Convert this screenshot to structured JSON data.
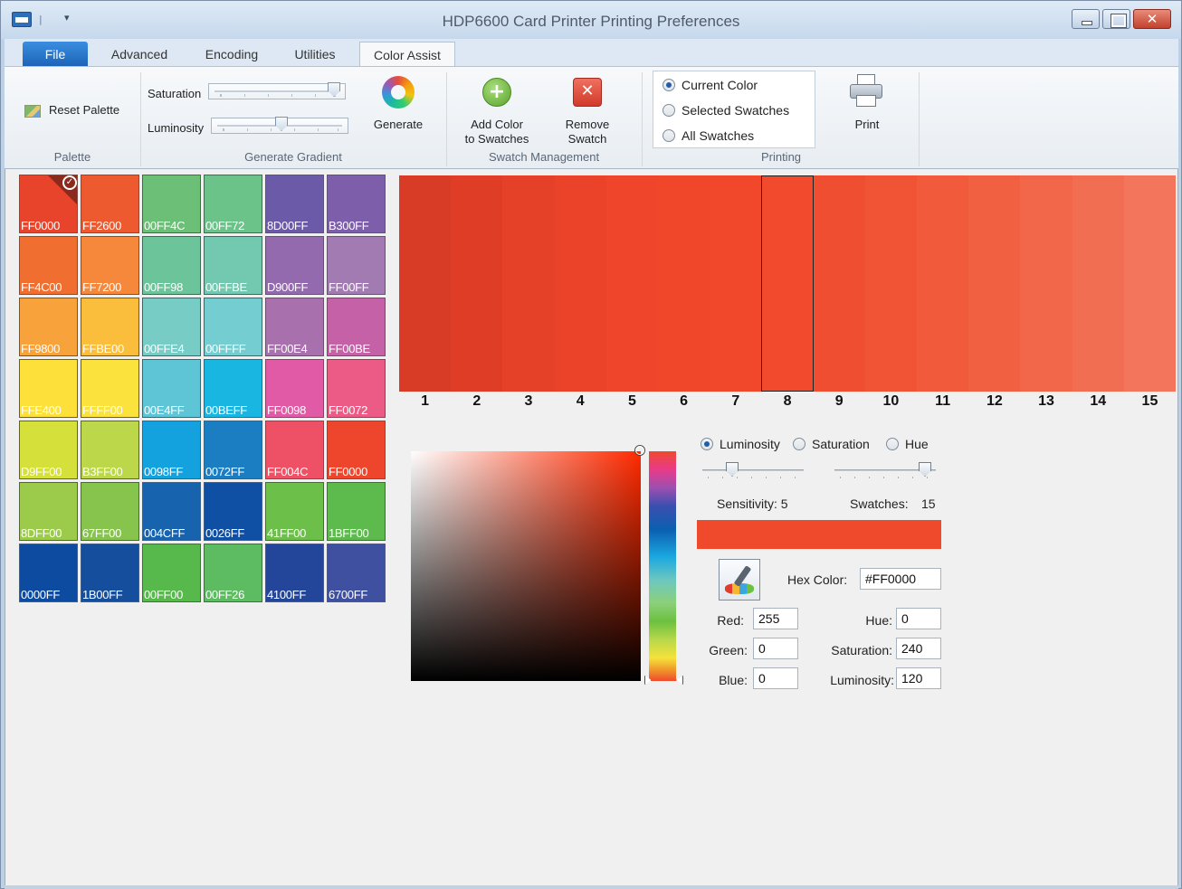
{
  "window": {
    "title": "HDP6600 Card Printer Printing Preferences"
  },
  "tabs": [
    {
      "label": "File"
    },
    {
      "label": "Advanced"
    },
    {
      "label": "Encoding"
    },
    {
      "label": "Utilities"
    },
    {
      "label": "Color Assist"
    }
  ],
  "ribbon": {
    "palette": {
      "reset_label": "Reset Palette",
      "group_label": "Palette"
    },
    "gradient": {
      "saturation_label": "Saturation",
      "luminosity_label": "Luminosity",
      "generate_label": "Generate",
      "group_label": "Generate Gradient",
      "saturation_value": 0.95,
      "luminosity_value": 0.5
    },
    "swatch_mgmt": {
      "add_line1": "Add Color",
      "add_line2": "to Swatches",
      "remove_line1": "Remove",
      "remove_line2": "Swatch",
      "group_label": "Swatch Management"
    },
    "printing": {
      "options": [
        "Current Color",
        "Selected Swatches",
        "All Swatches"
      ],
      "selected": "Current Color",
      "print_label": "Print",
      "group_label": "Printing"
    }
  },
  "palette": {
    "selected_index": 0,
    "swatches": [
      {
        "hex": "FF0000",
        "color": "#e8442c"
      },
      {
        "hex": "FF2600",
        "color": "#ee5a30"
      },
      {
        "hex": "00FF4C",
        "color": "#6bbf77"
      },
      {
        "hex": "00FF72",
        "color": "#6cc38a"
      },
      {
        "hex": "8D00FF",
        "color": "#6b5aa8"
      },
      {
        "hex": "B300FF",
        "color": "#7d5eaa"
      },
      {
        "hex": "FF4C00",
        "color": "#f06e30"
      },
      {
        "hex": "FF7200",
        "color": "#f5883a"
      },
      {
        "hex": "00FF98",
        "color": "#6cc59a"
      },
      {
        "hex": "00FFBE",
        "color": "#72c9af"
      },
      {
        "hex": "D900FF",
        "color": "#936aae"
      },
      {
        "hex": "FF00FF",
        "color": "#a37bb3"
      },
      {
        "hex": "FF9800",
        "color": "#f7a23a"
      },
      {
        "hex": "FFBE00",
        "color": "#fbbd3c"
      },
      {
        "hex": "00FFE4",
        "color": "#78ccc6"
      },
      {
        "hex": "00FFFF",
        "color": "#74cdd0"
      },
      {
        "hex": "FF00E4",
        "color": "#a970ae"
      },
      {
        "hex": "FF00BE",
        "color": "#c461a7"
      },
      {
        "hex": "FFE400",
        "color": "#fde13a"
      },
      {
        "hex": "FFFF00",
        "color": "#fce23c"
      },
      {
        "hex": "00E4FF",
        "color": "#5ec5d6"
      },
      {
        "hex": "00BEFF",
        "color": "#18b6e0"
      },
      {
        "hex": "FF0098",
        "color": "#e05aa6"
      },
      {
        "hex": "FF0072",
        "color": "#ec5a86"
      },
      {
        "hex": "D9FF00",
        "color": "#d5e03a"
      },
      {
        "hex": "B3FF00",
        "color": "#bcd74a"
      },
      {
        "hex": "0098FF",
        "color": "#13a2de"
      },
      {
        "hex": "0072FF",
        "color": "#1c7ec2"
      },
      {
        "hex": "FF004C",
        "color": "#ee5166"
      },
      {
        "hex": "FF0000",
        "color": "#ee462c"
      },
      {
        "hex": "8DFF00",
        "color": "#9ccb4c"
      },
      {
        "hex": "67FF00",
        "color": "#87c44e"
      },
      {
        "hex": "004CFF",
        "color": "#1763ae"
      },
      {
        "hex": "0026FF",
        "color": "#0f4fa4"
      },
      {
        "hex": "41FF00",
        "color": "#6cbf48"
      },
      {
        "hex": "1BFF00",
        "color": "#5dba4c"
      },
      {
        "hex": "0000FF",
        "color": "#0c4ba0"
      },
      {
        "hex": "1B00FF",
        "color": "#164e9e"
      },
      {
        "hex": "00FF00",
        "color": "#57b84c"
      },
      {
        "hex": "00FF26",
        "color": "#5dbc62"
      },
      {
        "hex": "4100FF",
        "color": "#23469a"
      },
      {
        "hex": "6700FF",
        "color": "#4050a0"
      }
    ]
  },
  "gradient_strip": {
    "selected": 8,
    "cells": [
      {
        "n": "1",
        "color": "#d93c26"
      },
      {
        "n": "2",
        "color": "#df3d26"
      },
      {
        "n": "3",
        "color": "#e54028"
      },
      {
        "n": "4",
        "color": "#eb432a"
      },
      {
        "n": "5",
        "color": "#ef452b"
      },
      {
        "n": "6",
        "color": "#f0472b"
      },
      {
        "n": "7",
        "color": "#f1482c"
      },
      {
        "n": "8",
        "color": "#f14a2d"
      },
      {
        "n": "9",
        "color": "#f04e30"
      },
      {
        "n": "10",
        "color": "#f05434"
      },
      {
        "n": "11",
        "color": "#f15a3a"
      },
      {
        "n": "12",
        "color": "#f16041"
      },
      {
        "n": "13",
        "color": "#f26749"
      },
      {
        "n": "14",
        "color": "#f26e52"
      },
      {
        "n": "15",
        "color": "#f2755c"
      }
    ]
  },
  "picker": {
    "mode_options": [
      "Luminosity",
      "Saturation",
      "Hue"
    ],
    "mode_selected": "Luminosity",
    "sensitivity_label": "Sensitivity: 5",
    "swatches_label": "Swatches:",
    "swatches_value": "15",
    "sensitivity_value": 0.25,
    "swatch_count_value": 0.95,
    "current_color": "#f04a2d",
    "hex_label": "Hex Color:",
    "hex_value": "#FF0000",
    "red_label": "Red:",
    "red_value": "255",
    "green_label": "Green:",
    "green_value": "0",
    "blue_label": "Blue:",
    "blue_value": "0",
    "hue_label": "Hue:",
    "hue_value": "0",
    "saturation_label": "Saturation:",
    "saturation_value": "240",
    "luminosity_label": "Luminosity:",
    "luminosity_value": "120"
  }
}
